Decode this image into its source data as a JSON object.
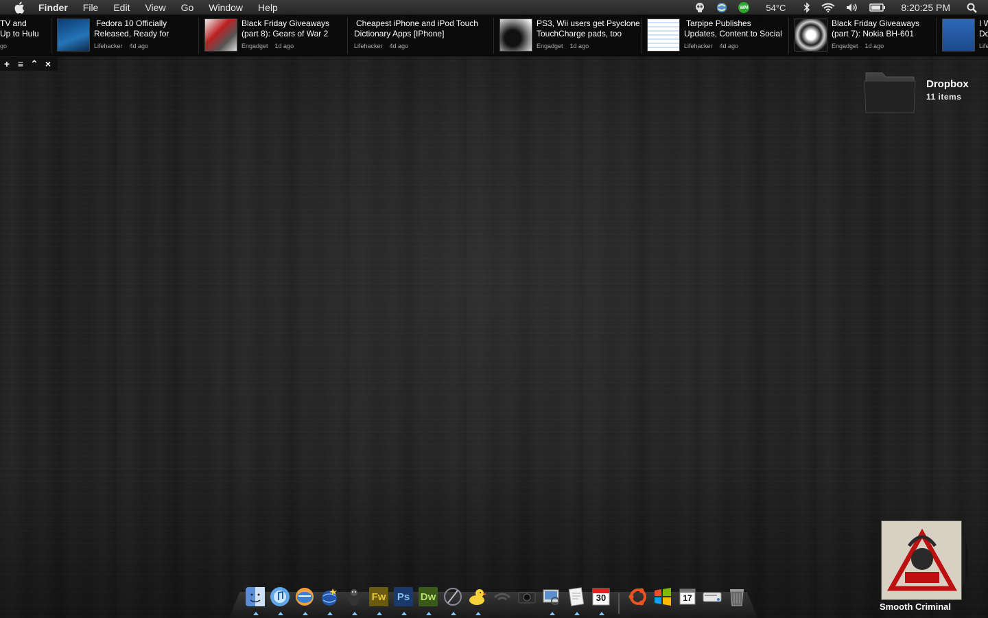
{
  "menubar": {
    "app_name": "Finder",
    "menus": [
      "File",
      "Edit",
      "View",
      "Go",
      "Window",
      "Help"
    ],
    "temperature": "54°C",
    "clock": "8:20:25 PM",
    "wm_badge": "WM"
  },
  "ticker": {
    "items": [
      {
        "title1": "TV and",
        "title2": "Up to Hulu",
        "source": "",
        "age": "go"
      },
      {
        "title1": "Fedora 10 Officially",
        "title2": "Released, Ready for",
        "source": "Lifehacker",
        "age": "4d ago"
      },
      {
        "title1": "Black Friday Giveaways",
        "title2": "(part 8): Gears of War 2",
        "source": "Engadget",
        "age": "1d ago"
      },
      {
        "title1": "Cheapest iPhone and iPod Touch",
        "title2": "Dictionary Apps [IPhone]",
        "source": "Lifehacker",
        "age": "4d ago"
      },
      {
        "title1": "PS3, Wii users get Psyclone",
        "title2": "TouchCharge pads, too",
        "source": "Engadget",
        "age": "1d ago"
      },
      {
        "title1": "Tarpipe Publishes",
        "title2": "Updates, Content to Social",
        "source": "Lifehacker",
        "age": "4d ago"
      },
      {
        "title1": "Black Friday Giveaways",
        "title2": "(part 7): Nokia BH-601",
        "source": "Engadget",
        "age": "1d ago"
      },
      {
        "title1": "I W",
        "title2": "Do",
        "source": "Life",
        "age": ""
      }
    ],
    "controls": [
      "+",
      "≡",
      "⌃",
      "×"
    ]
  },
  "dropbox": {
    "name": "Dropbox",
    "count": "11 items"
  },
  "album": {
    "track": "Smooth Criminal"
  },
  "dock": {
    "calendar_day": "30",
    "ical_day": "17",
    "fw": "Fw",
    "ps": "Ps",
    "dw": "Dw"
  },
  "colors": {
    "menubar": "#2e2e2e",
    "ticker": "#0a0a0a",
    "accent_indicator": "#7fc7ff"
  }
}
